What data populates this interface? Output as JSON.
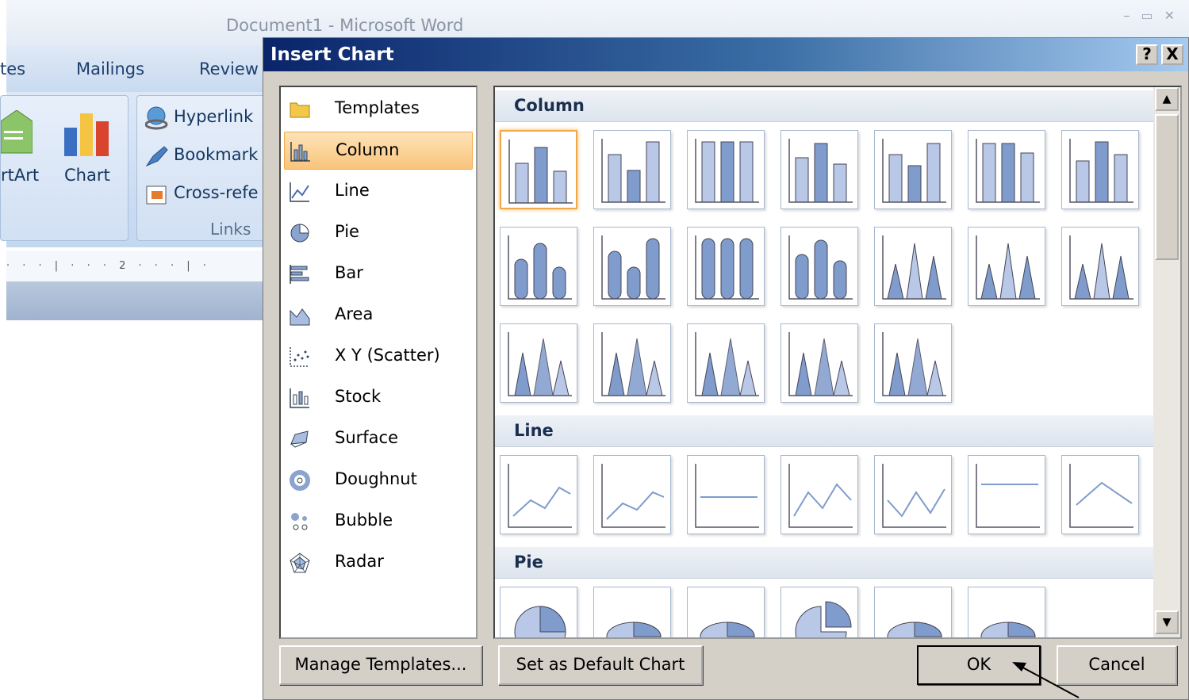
{
  "word": {
    "title": "Document1 - Microsoft Word",
    "tabs": [
      {
        "label": "tes"
      },
      {
        "label": "Mailings"
      },
      {
        "label": "Review"
      }
    ],
    "ribbon": {
      "smartart_label": "rtArt",
      "chart_label": "Chart",
      "hyperlink_label": "Hyperlink",
      "bookmark_label": "Bookmark",
      "crossref_label": "Cross-refe",
      "links_group_label": "Links"
    },
    "ruler_text": "· · · | · · · 2 · · · | ·"
  },
  "dialog": {
    "title": "Insert Chart",
    "help_button": "?",
    "close_button": "X",
    "categories": [
      {
        "label": "Templates",
        "icon": "folder-icon"
      },
      {
        "label": "Column",
        "icon": "column-chart-icon",
        "selected": true
      },
      {
        "label": "Line",
        "icon": "line-chart-icon"
      },
      {
        "label": "Pie",
        "icon": "pie-chart-icon"
      },
      {
        "label": "Bar",
        "icon": "bar-chart-icon"
      },
      {
        "label": "Area",
        "icon": "area-chart-icon"
      },
      {
        "label": "X Y (Scatter)",
        "icon": "scatter-chart-icon"
      },
      {
        "label": "Stock",
        "icon": "stock-chart-icon"
      },
      {
        "label": "Surface",
        "icon": "surface-chart-icon"
      },
      {
        "label": "Doughnut",
        "icon": "doughnut-chart-icon"
      },
      {
        "label": "Bubble",
        "icon": "bubble-chart-icon"
      },
      {
        "label": "Radar",
        "icon": "radar-chart-icon"
      }
    ],
    "sections": {
      "column": {
        "label": "Column",
        "count": 19
      },
      "line": {
        "label": "Line",
        "count": 7
      },
      "pie": {
        "label": "Pie",
        "count": 6
      }
    },
    "buttons": {
      "manage_templates": "Manage Templates...",
      "set_default": "Set as Default Chart",
      "ok": "OK",
      "cancel": "Cancel"
    },
    "colors": {
      "selection": "#f9c47c",
      "chart_fill": "#7f9ccc",
      "title_start": "#0a246a",
      "title_end": "#a6caf0"
    }
  }
}
